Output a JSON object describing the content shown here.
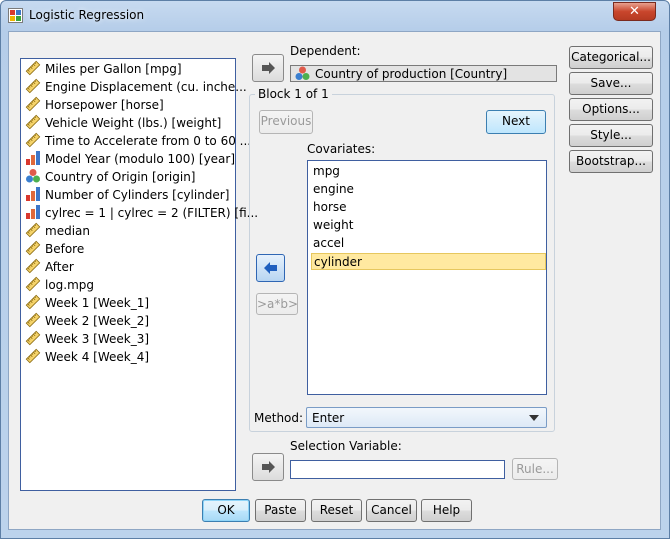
{
  "window": {
    "title": "Logistic Regression",
    "close_label": "✕"
  },
  "variables": [
    {
      "label": "Miles per Gallon [mpg]",
      "icon": "scale-icon"
    },
    {
      "label": "Engine Displacement (cu. inche...",
      "icon": "scale-icon"
    },
    {
      "label": "Horsepower [horse]",
      "icon": "scale-icon"
    },
    {
      "label": "Vehicle Weight (lbs.) [weight]",
      "icon": "scale-icon"
    },
    {
      "label": "Time to Accelerate from 0 to 60 ...",
      "icon": "scale-icon"
    },
    {
      "label": "Model Year (modulo 100) [year]",
      "icon": "ordinal-icon"
    },
    {
      "label": "Country of Origin [origin]",
      "icon": "nominal-icon"
    },
    {
      "label": "Number of Cylinders [cylinder]",
      "icon": "ordinal-icon"
    },
    {
      "label": "cylrec = 1 | cylrec = 2 (FILTER) [fi...",
      "icon": "ordinal-icon"
    },
    {
      "label": "median",
      "icon": "scale-icon"
    },
    {
      "label": "Before",
      "icon": "scale-icon"
    },
    {
      "label": "After",
      "icon": "scale-icon"
    },
    {
      "label": "log.mpg",
      "icon": "scale-icon"
    },
    {
      "label": "Week 1 [Week_1]",
      "icon": "scale-icon"
    },
    {
      "label": "Week 2 [Week_2]",
      "icon": "scale-icon"
    },
    {
      "label": "Week 3 [Week_3]",
      "icon": "scale-icon"
    },
    {
      "label": "Week 4 [Week_4]",
      "icon": "scale-icon"
    }
  ],
  "dependent": {
    "label": "Dependent:",
    "value": "Country of production [Country]"
  },
  "block": {
    "title": "Block 1 of 1",
    "previous_label": "Previous",
    "next_label": "Next",
    "covariates_label": "Covariates:",
    "covariates": [
      "mpg",
      "engine",
      "horse",
      "weight",
      "accel",
      "cylinder"
    ],
    "selected_index": 5,
    "interaction_label": ">a*b>",
    "method_label": "Method:",
    "method_value": "Enter"
  },
  "selection": {
    "label": "Selection Variable:",
    "value": "",
    "rule_label": "Rule..."
  },
  "side_buttons": [
    "Categorical...",
    "Save...",
    "Options...",
    "Style...",
    "Bootstrap..."
  ],
  "bottom_buttons": [
    "OK",
    "Paste",
    "Reset",
    "Cancel",
    "Help"
  ],
  "colors": {
    "selected_row": "#ffe9a0",
    "title_bar": "#b5cde9",
    "close_button": "#c9462c"
  }
}
